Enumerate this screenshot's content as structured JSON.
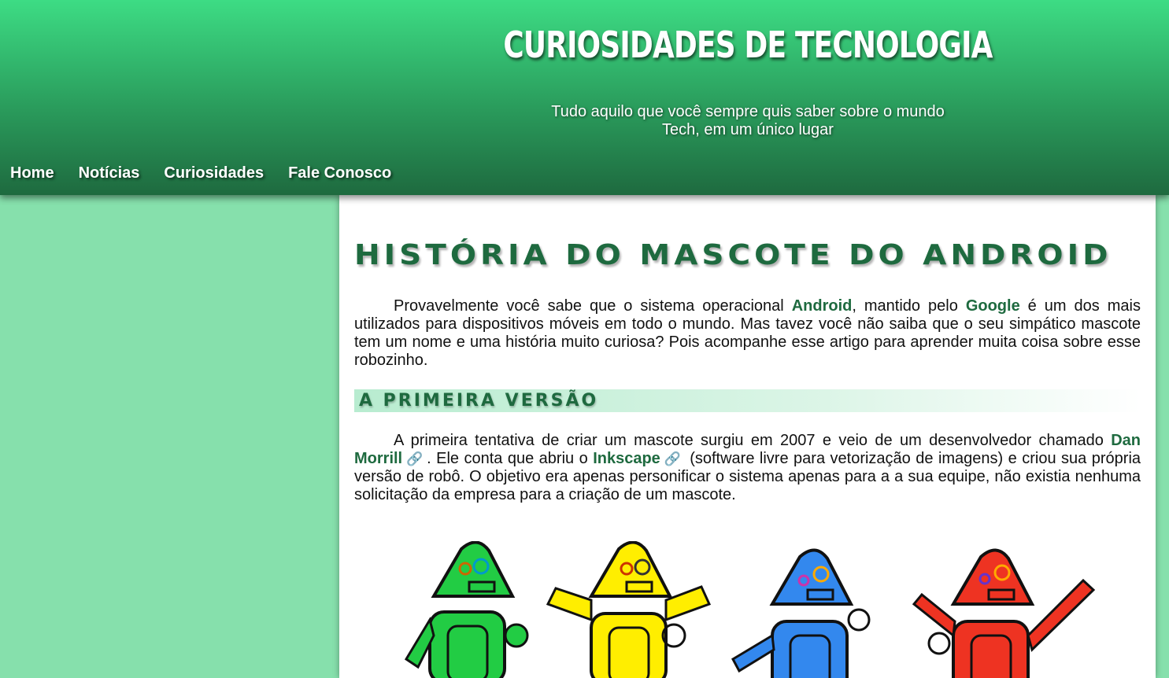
{
  "header": {
    "site_title": "CURIOSIDADES DE TECNOLOGIA",
    "subtitle_line1": "Tudo aquilo que você sempre quis saber sobre o mundo",
    "subtitle_line2": "Tech, em um único lugar"
  },
  "nav": {
    "items": [
      {
        "label": "Home"
      },
      {
        "label": "Notícias"
      },
      {
        "label": "Curiosidades"
      },
      {
        "label": "Fale Conosco"
      }
    ]
  },
  "article": {
    "title": "HISTÓRIA DO MASCOTE DO ANDROID",
    "intro": {
      "t1": "Provavelmente você sabe que o sistema operacional ",
      "android": "Android",
      "t2": ", mantido pelo ",
      "google": "Google",
      "t3": " é um dos mais utilizados para dispositivos móveis em todo o mundo. Mas tavez você não saiba que o seu simpático mascote tem um nome e uma história muito curiosa? Pois acompanhe esse artigo para aprender muita coisa sobre esse robozinho."
    },
    "section1": {
      "heading": "A PRIMEIRA VERSÃO",
      "t1": "A primeira tentativa de criar um mascote surgiu em 2007 e veio de um desenvolvedor chamado ",
      "dan_link": "Dan Morrill",
      "t2": ". Ele conta que abriu o ",
      "inkscape_link": "Inkscape",
      "t3": " (software livre para vetorização de imagens) e criou sua própria versão de robô. O objetivo era apenas personificar o sistema apenas para a a sua equipe, não existia nenhuma solicitação da empresa para a criação de um mascote."
    },
    "robot_colors": [
      "#22cc44",
      "#ffee00",
      "#3388ee",
      "#ee3322"
    ]
  },
  "colors": {
    "header_top": "#3ddc84",
    "header_bottom": "#1e6a3f",
    "page_bg": "#86e0ac",
    "accent": "#1e6a3f"
  }
}
